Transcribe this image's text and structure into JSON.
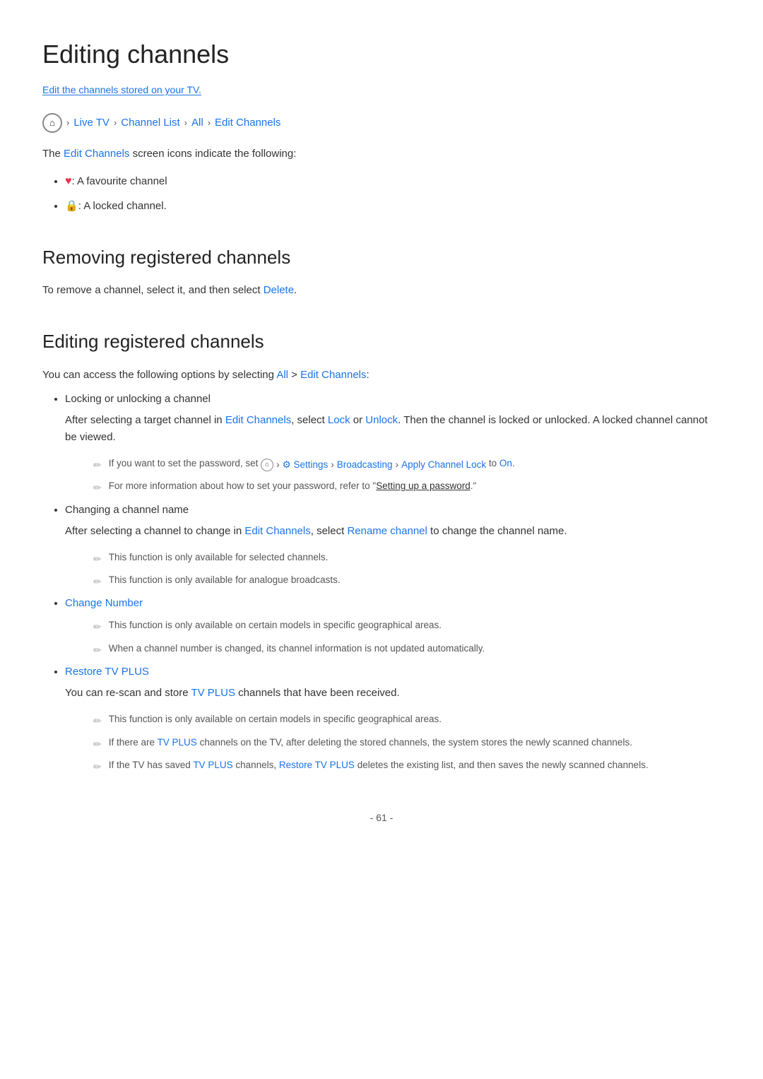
{
  "page": {
    "title": "Editing channels",
    "subtitle": "Edit the channels stored on your TV.",
    "breadcrumb": {
      "home_label": "⌂",
      "items": [
        "Live TV",
        "Channel List",
        "All",
        "Edit Channels"
      ]
    },
    "intro": {
      "text_before": "The ",
      "link": "Edit Channels",
      "text_after": " screen icons indicate the following:"
    },
    "icons_list": [
      {
        "icon_type": "heart",
        "icon_char": "♥",
        "label": ": A favourite channel"
      },
      {
        "icon_type": "lock",
        "icon_char": "🔒",
        "label": ": A locked channel."
      }
    ],
    "section1": {
      "title": "Removing registered channels",
      "text_before": "To remove a channel, select it, and then select ",
      "link": "Delete",
      "text_after": "."
    },
    "section2": {
      "title": "Editing registered channels",
      "intro_before": "You can access the following options by selecting ",
      "intro_link1": "All",
      "intro_middle": " > ",
      "intro_link2": "Edit Channels",
      "intro_after": ":",
      "items": [
        {
          "label": "Locking or unlocking a channel",
          "description_before": "After selecting a target channel in ",
          "description_link1": "Edit Channels",
          "description_middle": ", select ",
          "description_link2": "Lock",
          "description_or": " or ",
          "description_link3": "Unlock",
          "description_after": ". Then the channel is locked or unlocked. A locked channel cannot be viewed.",
          "notes": [
            {
              "type": "inline-path",
              "text_before": "If you want to set the password, set ",
              "home": "⌂",
              "path_items": [
                "Settings",
                "Broadcasting",
                "Apply Channel Lock"
              ],
              "text_after": " to ",
              "link_word": "On",
              "text_end": "."
            },
            {
              "type": "link-note",
              "text_before": "For more information about how to set your password, refer to \"",
              "link": "Setting up a password",
              "text_after": ".\""
            }
          ]
        },
        {
          "label": "Changing a channel name",
          "description_before": "After selecting a channel to change in ",
          "description_link1": "Edit Channels",
          "description_middle": ", select ",
          "description_link2": "Rename channel",
          "description_after": " to change the channel name.",
          "notes": [
            {
              "type": "plain",
              "text": "This function is only available for selected channels."
            },
            {
              "type": "plain",
              "text": "This function is only available for analogue broadcasts."
            }
          ]
        },
        {
          "label": "Change Number",
          "label_is_link": true,
          "notes": [
            {
              "type": "plain",
              "text": "This function is only available on certain models in specific geographical areas."
            },
            {
              "type": "plain",
              "text": "When a channel number is changed, its channel information is not updated automatically."
            }
          ]
        },
        {
          "label": "Restore TV PLUS",
          "label_is_link": true,
          "description_before": "You can re-scan and store ",
          "description_link1": "TV PLUS",
          "description_after": " channels that have been received.",
          "notes": [
            {
              "type": "plain",
              "text": "This function is only available on certain models in specific geographical areas."
            },
            {
              "type": "tvplus-note1",
              "text_before": "If there are ",
              "link": "TV PLUS",
              "text_after": " channels on the TV, after deleting the stored channels, the system stores the newly scanned channels."
            },
            {
              "type": "tvplus-note2",
              "text_before": "If the TV has saved ",
              "link1": "TV PLUS",
              "text_middle": " channels, ",
              "link2": "Restore TV PLUS",
              "text_after": " deletes the existing list, and then saves the newly scanned channels."
            }
          ]
        }
      ]
    },
    "footer": {
      "page_number": "- 61 -"
    }
  }
}
